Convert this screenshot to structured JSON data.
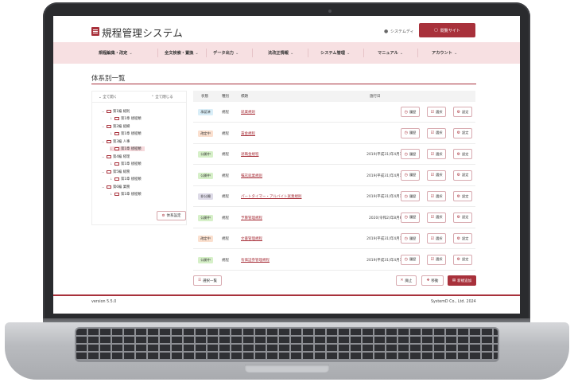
{
  "header": {
    "app_title": "規程管理システム",
    "user_name": "システムディ",
    "site_button": "閲覧サイト"
  },
  "nav": [
    {
      "label": "規程編集・改定"
    },
    {
      "label": "全文検索・置換"
    },
    {
      "label": "データ出力"
    },
    {
      "label": "法改正情報"
    },
    {
      "label": "システム管理"
    },
    {
      "label": "マニュアル"
    },
    {
      "label": "アカウント"
    }
  ],
  "page": {
    "title": "体系別一覧"
  },
  "tree": {
    "expand_all": "全て開く",
    "collapse_all": "全て閉じる",
    "items": [
      {
        "label": "第1編 総則",
        "level": 0
      },
      {
        "label": "第1章 規程類",
        "level": 1
      },
      {
        "label": "第2編 組織",
        "level": 0
      },
      {
        "label": "第1章 規程類",
        "level": 1
      },
      {
        "label": "第3編 人事",
        "level": 0
      },
      {
        "label": "第1章 規程類",
        "level": 1,
        "selected": true
      },
      {
        "label": "第4編 経理",
        "level": 0
      },
      {
        "label": "第1章 規程類",
        "level": 1
      },
      {
        "label": "第5編 総務",
        "level": 0
      },
      {
        "label": "第1章 規程類",
        "level": 1
      },
      {
        "label": "第6編 業務",
        "level": 0
      },
      {
        "label": "第1章 規程類",
        "level": 1
      }
    ],
    "settings_button": "体系設定"
  },
  "table": {
    "headers": {
      "status": "状態",
      "type": "種別",
      "name": "標題",
      "date": "施行日"
    },
    "row_buttons": {
      "history": "履歴",
      "select": "選択",
      "settings": "設定"
    },
    "rows": [
      {
        "status": "承認済",
        "status_color": "#d9eef8",
        "type": "規程",
        "name": "就業規則",
        "date": ""
      },
      {
        "status": "改定中",
        "status_color": "#fbe0cf",
        "type": "規程",
        "name": "賃金規程",
        "date": ""
      },
      {
        "status": "公開中",
        "status_color": "#d6f0c8",
        "type": "規程",
        "name": "退職金規程",
        "date": "2019(平成31)年4月1日"
      },
      {
        "status": "公開中",
        "status_color": "#d6f0c8",
        "type": "規程",
        "name": "嘱託就業規則",
        "date": "2019(平成31)年4月1日"
      },
      {
        "status": "非公開",
        "status_color": "#dedbe8",
        "type": "規程",
        "name": "パートタイマー・アルバイト就業規則",
        "date": "2019(平成31)年4月1日"
      },
      {
        "status": "公開中",
        "status_color": "#d6f0c8",
        "type": "規程",
        "name": "予算管理規程",
        "date": "2020(令和2)年8月6日"
      },
      {
        "status": "改定中",
        "status_color": "#fbe0cf",
        "type": "規程",
        "name": "文書管理規程",
        "date": "2019(平成31)年4月1日"
      },
      {
        "status": "公開中",
        "status_color": "#d6f0c8",
        "type": "規程",
        "name": "有価証券管理規程",
        "date": "2019(平成31)年4月1日"
      }
    ]
  },
  "actions": {
    "select_list": "選択一覧",
    "abolish": "廃止",
    "move": "移動",
    "add_new": "新規追加"
  },
  "footer": {
    "version": "version 5.5.0",
    "copyright": "SystemD Co., Ltd. 2024"
  },
  "colors": {
    "accent": "#a8313b",
    "nav_bg": "#f7e0e2"
  }
}
